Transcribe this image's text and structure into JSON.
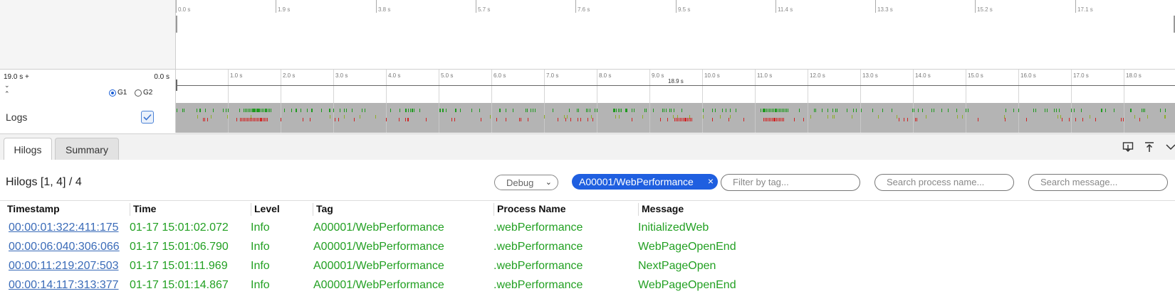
{
  "overview": {
    "ticks": [
      "0.0 s",
      "1.9 s",
      "3.8 s",
      "5.7 s",
      "7.6 s",
      "9.5 s",
      "11.4 s",
      "13.3 s",
      "15.2 s",
      "17.1 s"
    ]
  },
  "ruler": {
    "range_start": "19.0 s +",
    "range_end": "0.0 s",
    "ticks": [
      "1.0 s",
      "2.0 s",
      "3.0 s",
      "4.0 s",
      "5.0 s",
      "6.0 s",
      "7.0 s",
      "8.0 s",
      "9.0 s",
      "10.0 s",
      "11.0 s",
      "12.0 s",
      "13.0 s",
      "14.0 s",
      "15.0 s",
      "16.0 s",
      "17.0 s",
      "18.0 s"
    ],
    "cursor_label": "18.9 s",
    "chevron_down": "⌄",
    "chevron_up": "⌃",
    "radio_g1": "G1",
    "radio_g2": "G2",
    "selected_group": "G1"
  },
  "logs_lane": {
    "title": "Logs",
    "checked": true
  },
  "tabs": [
    {
      "label": "Hilogs",
      "active": true
    },
    {
      "label": "Summary",
      "active": false
    }
  ],
  "toolbar_icons": [
    "download-icon",
    "pin-top-icon",
    "collapse-icon"
  ],
  "panel": {
    "count_label": "Hilogs [1, 4] / 4",
    "level_select": "Debug",
    "tag_chip": "A00001/WebPerformance",
    "tag_chip_remove": "×",
    "tag_filter_placeholder": "Filter by tag...",
    "process_filter_placeholder": "Search process name...",
    "message_filter_placeholder": "Search message..."
  },
  "table": {
    "columns": [
      "Timestamp",
      "Time",
      "Level",
      "Tag",
      "Process Name",
      "Message"
    ],
    "rows": [
      {
        "timestamp": "00:00:01:322:411:175",
        "time": "01-17 15:01:02.072",
        "level": "Info",
        "tag": "A00001/WebPerformance",
        "process": ".webPerformance",
        "message": "InitializedWeb"
      },
      {
        "timestamp": "00:00:06:040:306:066",
        "time": "01-17 15:01:06.790",
        "level": "Info",
        "tag": "A00001/WebPerformance",
        "process": ".webPerformance",
        "message": "WebPageOpenEnd"
      },
      {
        "timestamp": "00:00:11:219:207:503",
        "time": "01-17 15:01:11.969",
        "level": "Info",
        "tag": "A00001/WebPerformance",
        "process": ".webPerformance",
        "message": "NextPageOpen"
      },
      {
        "timestamp": "00:00:14:117:313:377",
        "time": "01-17 15:01:14.867",
        "level": "Info",
        "tag": "A00001/WebPerformance",
        "process": ".webPerformance",
        "message": "WebPageOpenEnd"
      }
    ]
  },
  "colors": {
    "accent": "#1f5fe0",
    "info_text": "#22a022",
    "link": "#3a6bb8",
    "log_green": "#1f9a1f",
    "log_red": "#d12424"
  }
}
